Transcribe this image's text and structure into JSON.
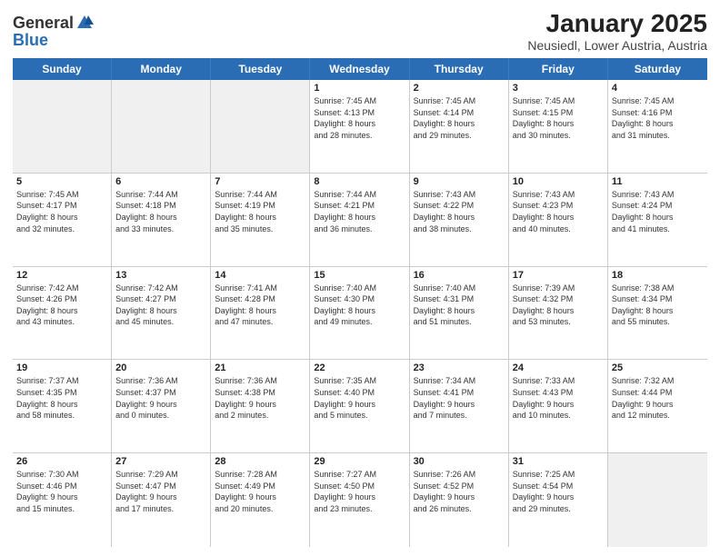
{
  "header": {
    "logo_general": "General",
    "logo_blue": "Blue",
    "title": "January 2025",
    "location": "Neusiedl, Lower Austria, Austria"
  },
  "weekdays": [
    "Sunday",
    "Monday",
    "Tuesday",
    "Wednesday",
    "Thursday",
    "Friday",
    "Saturday"
  ],
  "weeks": [
    [
      {
        "day": "",
        "info": "",
        "shaded": true
      },
      {
        "day": "",
        "info": "",
        "shaded": true
      },
      {
        "day": "",
        "info": "",
        "shaded": true
      },
      {
        "day": "1",
        "info": "Sunrise: 7:45 AM\nSunset: 4:13 PM\nDaylight: 8 hours\nand 28 minutes.",
        "shaded": false
      },
      {
        "day": "2",
        "info": "Sunrise: 7:45 AM\nSunset: 4:14 PM\nDaylight: 8 hours\nand 29 minutes.",
        "shaded": false
      },
      {
        "day": "3",
        "info": "Sunrise: 7:45 AM\nSunset: 4:15 PM\nDaylight: 8 hours\nand 30 minutes.",
        "shaded": false
      },
      {
        "day": "4",
        "info": "Sunrise: 7:45 AM\nSunset: 4:16 PM\nDaylight: 8 hours\nand 31 minutes.",
        "shaded": false
      }
    ],
    [
      {
        "day": "5",
        "info": "Sunrise: 7:45 AM\nSunset: 4:17 PM\nDaylight: 8 hours\nand 32 minutes.",
        "shaded": false
      },
      {
        "day": "6",
        "info": "Sunrise: 7:44 AM\nSunset: 4:18 PM\nDaylight: 8 hours\nand 33 minutes.",
        "shaded": false
      },
      {
        "day": "7",
        "info": "Sunrise: 7:44 AM\nSunset: 4:19 PM\nDaylight: 8 hours\nand 35 minutes.",
        "shaded": false
      },
      {
        "day": "8",
        "info": "Sunrise: 7:44 AM\nSunset: 4:21 PM\nDaylight: 8 hours\nand 36 minutes.",
        "shaded": false
      },
      {
        "day": "9",
        "info": "Sunrise: 7:43 AM\nSunset: 4:22 PM\nDaylight: 8 hours\nand 38 minutes.",
        "shaded": false
      },
      {
        "day": "10",
        "info": "Sunrise: 7:43 AM\nSunset: 4:23 PM\nDaylight: 8 hours\nand 40 minutes.",
        "shaded": false
      },
      {
        "day": "11",
        "info": "Sunrise: 7:43 AM\nSunset: 4:24 PM\nDaylight: 8 hours\nand 41 minutes.",
        "shaded": false
      }
    ],
    [
      {
        "day": "12",
        "info": "Sunrise: 7:42 AM\nSunset: 4:26 PM\nDaylight: 8 hours\nand 43 minutes.",
        "shaded": false
      },
      {
        "day": "13",
        "info": "Sunrise: 7:42 AM\nSunset: 4:27 PM\nDaylight: 8 hours\nand 45 minutes.",
        "shaded": false
      },
      {
        "day": "14",
        "info": "Sunrise: 7:41 AM\nSunset: 4:28 PM\nDaylight: 8 hours\nand 47 minutes.",
        "shaded": false
      },
      {
        "day": "15",
        "info": "Sunrise: 7:40 AM\nSunset: 4:30 PM\nDaylight: 8 hours\nand 49 minutes.",
        "shaded": false
      },
      {
        "day": "16",
        "info": "Sunrise: 7:40 AM\nSunset: 4:31 PM\nDaylight: 8 hours\nand 51 minutes.",
        "shaded": false
      },
      {
        "day": "17",
        "info": "Sunrise: 7:39 AM\nSunset: 4:32 PM\nDaylight: 8 hours\nand 53 minutes.",
        "shaded": false
      },
      {
        "day": "18",
        "info": "Sunrise: 7:38 AM\nSunset: 4:34 PM\nDaylight: 8 hours\nand 55 minutes.",
        "shaded": false
      }
    ],
    [
      {
        "day": "19",
        "info": "Sunrise: 7:37 AM\nSunset: 4:35 PM\nDaylight: 8 hours\nand 58 minutes.",
        "shaded": false
      },
      {
        "day": "20",
        "info": "Sunrise: 7:36 AM\nSunset: 4:37 PM\nDaylight: 9 hours\nand 0 minutes.",
        "shaded": false
      },
      {
        "day": "21",
        "info": "Sunrise: 7:36 AM\nSunset: 4:38 PM\nDaylight: 9 hours\nand 2 minutes.",
        "shaded": false
      },
      {
        "day": "22",
        "info": "Sunrise: 7:35 AM\nSunset: 4:40 PM\nDaylight: 9 hours\nand 5 minutes.",
        "shaded": false
      },
      {
        "day": "23",
        "info": "Sunrise: 7:34 AM\nSunset: 4:41 PM\nDaylight: 9 hours\nand 7 minutes.",
        "shaded": false
      },
      {
        "day": "24",
        "info": "Sunrise: 7:33 AM\nSunset: 4:43 PM\nDaylight: 9 hours\nand 10 minutes.",
        "shaded": false
      },
      {
        "day": "25",
        "info": "Sunrise: 7:32 AM\nSunset: 4:44 PM\nDaylight: 9 hours\nand 12 minutes.",
        "shaded": false
      }
    ],
    [
      {
        "day": "26",
        "info": "Sunrise: 7:30 AM\nSunset: 4:46 PM\nDaylight: 9 hours\nand 15 minutes.",
        "shaded": false
      },
      {
        "day": "27",
        "info": "Sunrise: 7:29 AM\nSunset: 4:47 PM\nDaylight: 9 hours\nand 17 minutes.",
        "shaded": false
      },
      {
        "day": "28",
        "info": "Sunrise: 7:28 AM\nSunset: 4:49 PM\nDaylight: 9 hours\nand 20 minutes.",
        "shaded": false
      },
      {
        "day": "29",
        "info": "Sunrise: 7:27 AM\nSunset: 4:50 PM\nDaylight: 9 hours\nand 23 minutes.",
        "shaded": false
      },
      {
        "day": "30",
        "info": "Sunrise: 7:26 AM\nSunset: 4:52 PM\nDaylight: 9 hours\nand 26 minutes.",
        "shaded": false
      },
      {
        "day": "31",
        "info": "Sunrise: 7:25 AM\nSunset: 4:54 PM\nDaylight: 9 hours\nand 29 minutes.",
        "shaded": false
      },
      {
        "day": "",
        "info": "",
        "shaded": true
      }
    ]
  ]
}
